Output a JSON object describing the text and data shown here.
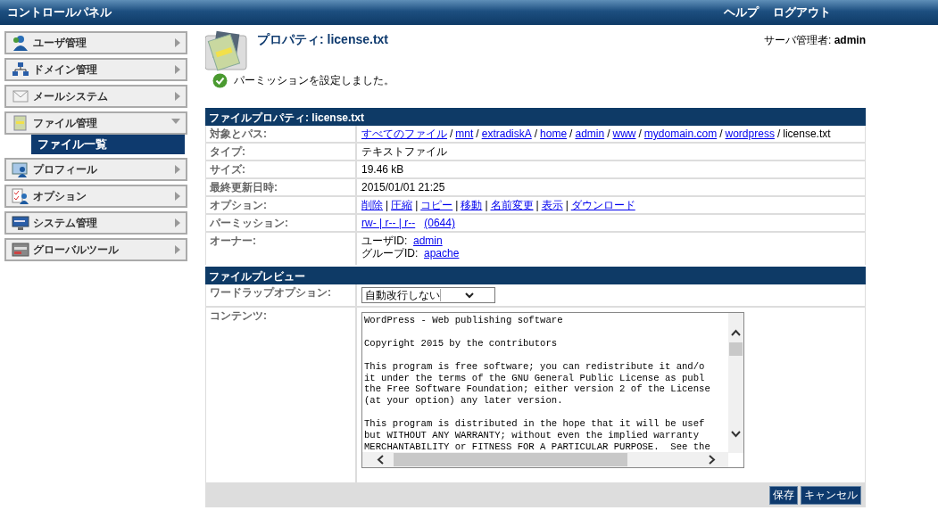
{
  "header": {
    "title": "コントロールパネル",
    "links": [
      "ヘルプ",
      "ログアウト"
    ]
  },
  "sidebar": {
    "items": [
      {
        "label": "ユーザ管理",
        "expanded": false
      },
      {
        "label": "ドメイン管理",
        "expanded": false
      },
      {
        "label": "メールシステム",
        "expanded": false
      },
      {
        "label": "ファイル管理",
        "expanded": true,
        "children": [
          {
            "label": "ファイル一覧",
            "selected": true
          }
        ]
      },
      {
        "label": "プロフィール",
        "expanded": false
      },
      {
        "label": "オプション",
        "expanded": false
      },
      {
        "label": "システム管理",
        "expanded": false
      },
      {
        "label": "グローバルツール",
        "expanded": false
      }
    ]
  },
  "page": {
    "title": "プロパティ: license.txt",
    "admin_label": "サーバ管理者:",
    "admin_name": "admin",
    "message": "パーミッションを設定しました。"
  },
  "properties": {
    "title": "ファイルプロパティ: license.txt",
    "rows": [
      {
        "label": "対象とパス:",
        "kind": "path",
        "links": [
          "すべてのファイル",
          "mnt",
          "extradiskA",
          "home",
          "admin",
          "www",
          "mydomain.com",
          "wordpress"
        ],
        "separator": "/",
        "current": "license.txt"
      },
      {
        "label": "タイプ:",
        "kind": "text",
        "value": "テキストファイル"
      },
      {
        "label": "サイズ:",
        "kind": "text",
        "value": "19.46  kB"
      },
      {
        "label": "最終更新日時:",
        "kind": "text",
        "value": "2015/01/01 21:25"
      },
      {
        "label": "オプション:",
        "kind": "links",
        "links": [
          "削除",
          "圧縮",
          "コピー",
          "移動",
          "名前変更",
          "表示",
          "ダウンロード"
        ],
        "separator": "|"
      },
      {
        "label": "パーミッション:",
        "kind": "permission",
        "link": "rw- | r-- | r--",
        "octal": "(0644)"
      },
      {
        "label": "オーナー:",
        "kind": "owner",
        "owners": [
          {
            "label": "ユーザID:",
            "value": "admin"
          },
          {
            "label": "グループID:",
            "value": "apache"
          }
        ]
      }
    ]
  },
  "preview": {
    "title": "ファイルプレビュー",
    "wrap_label": "ワードラップオプション:",
    "wrap_value": "自動改行しない",
    "content_label": "コンテンツ:",
    "paragraphs": [
      [
        "WordPress - Web publishing software"
      ],
      [
        "Copyright 2015 by the contributors"
      ],
      [
        "This program is free software; you can redistribute it and/o",
        "it under the terms of the GNU General Public License as publ",
        "the Free Software Foundation; either version 2 of the License",
        "(at your option) any later version."
      ],
      [
        "This program is distributed in the hope that it will be usef",
        "but WITHOUT ANY WARRANTY; without even the implied warranty",
        "MERCHANTABILITY or FITNESS FOR A PARTICULAR PURPOSE.  See the"
      ]
    ]
  },
  "buttons": [
    "保存",
    "キャンセル"
  ]
}
